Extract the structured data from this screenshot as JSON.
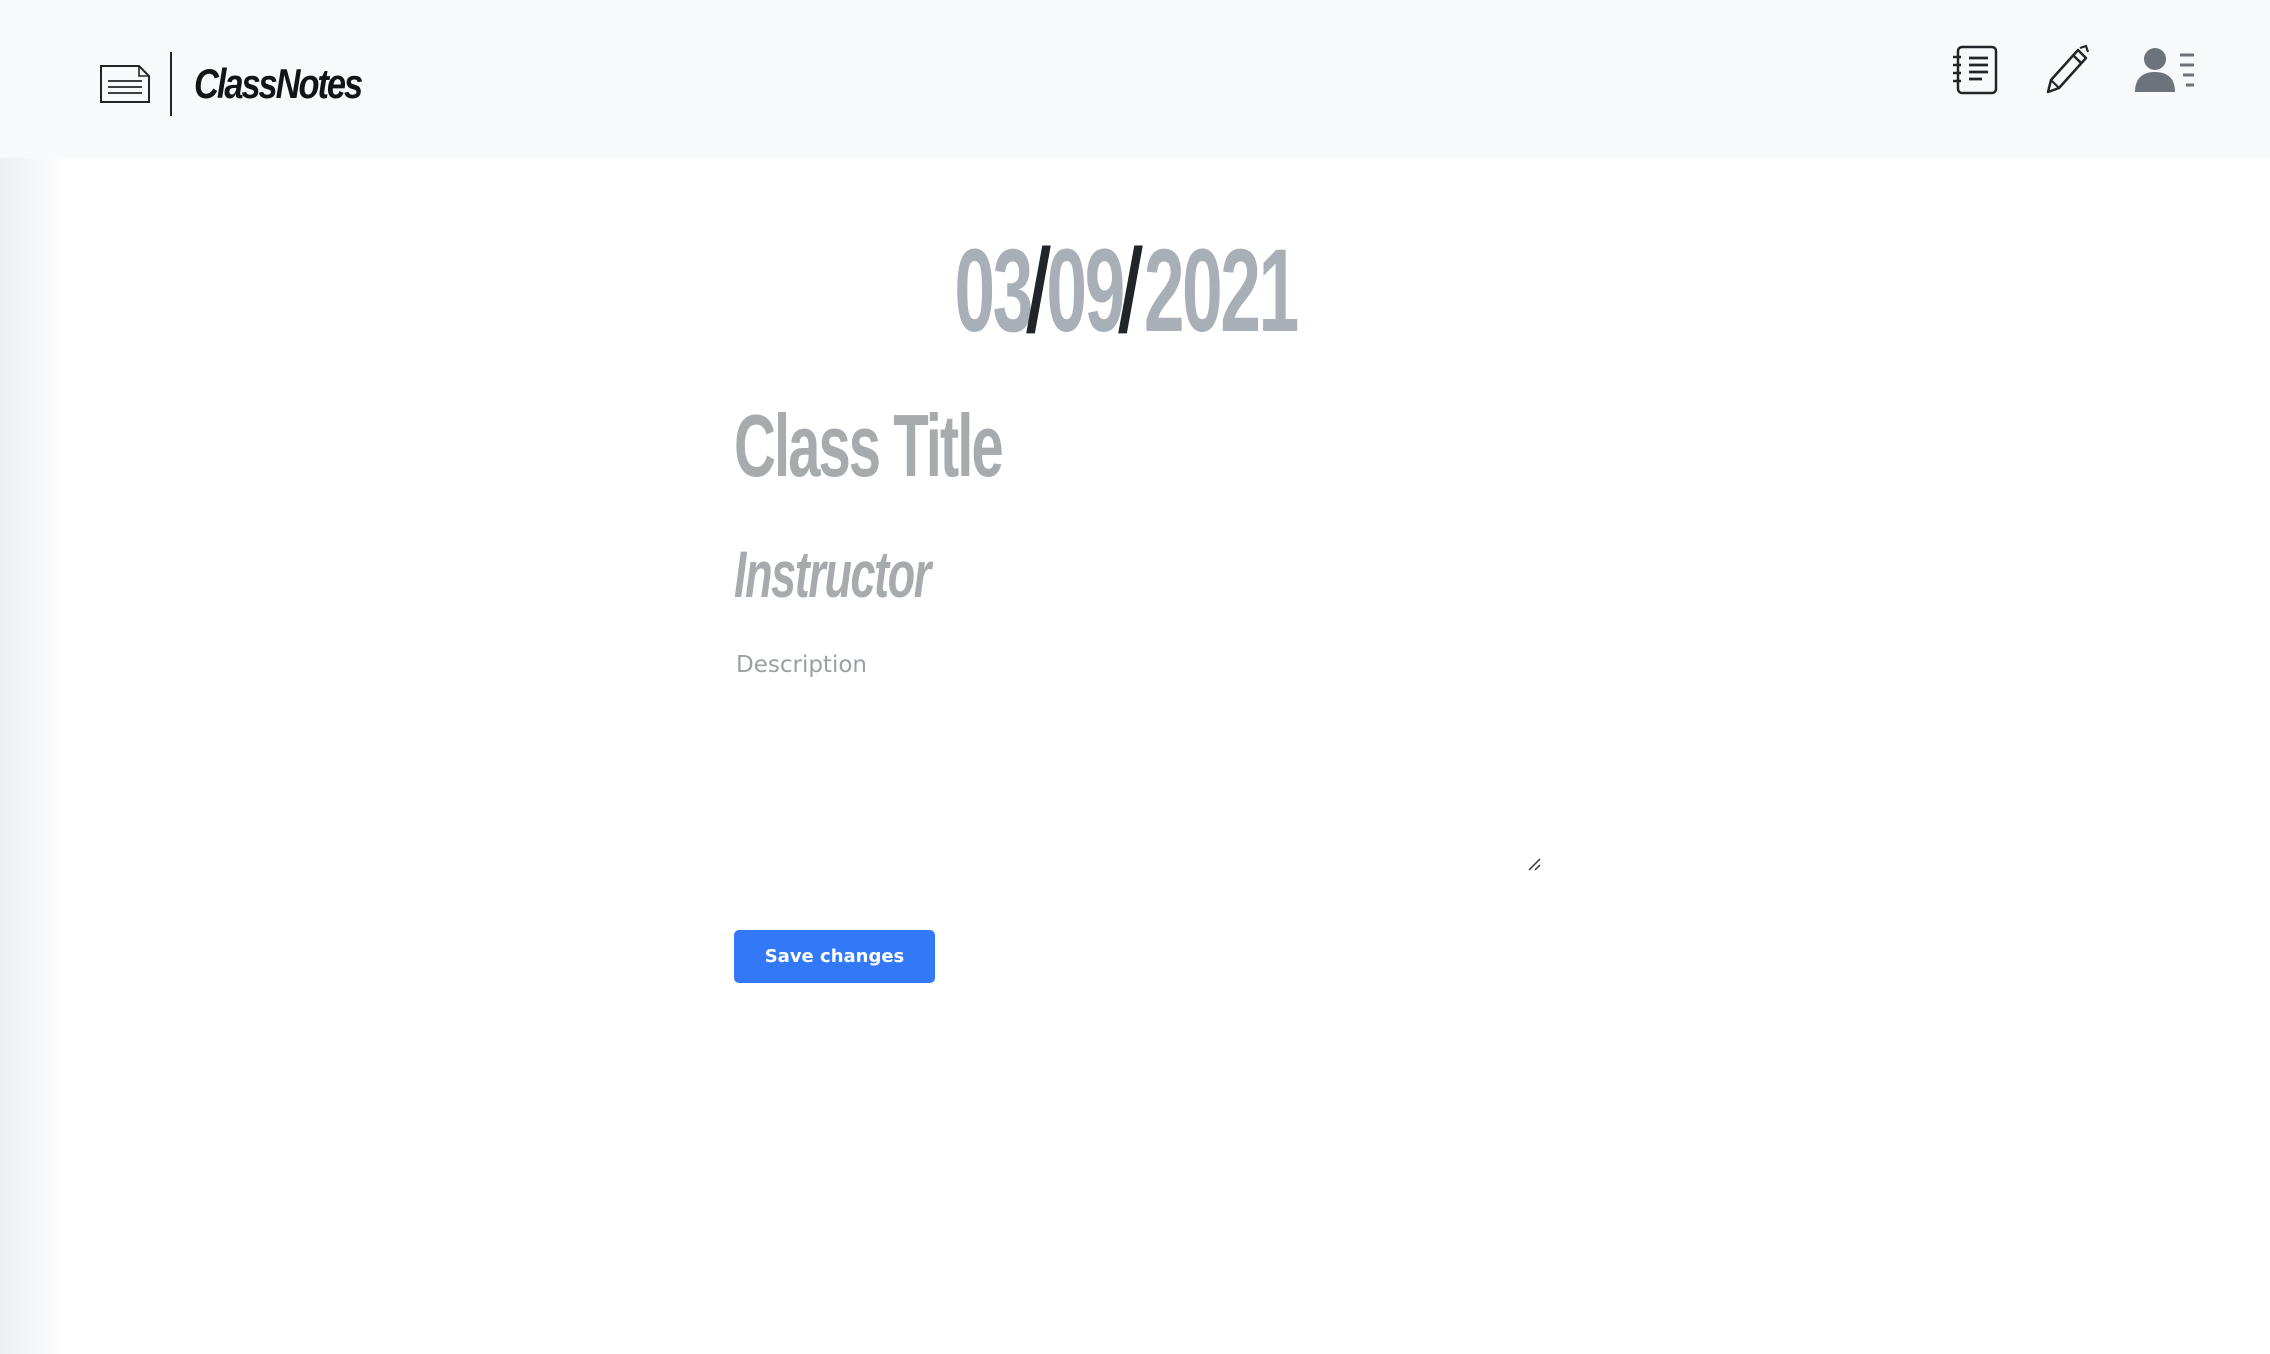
{
  "app": {
    "brand_name": "ClassNotes",
    "brand_icon": "document-lines-icon"
  },
  "nav": {
    "items": [
      {
        "icon": "notebook-list-icon"
      },
      {
        "icon": "pencil-icon"
      },
      {
        "icon": "user-profile-icon"
      }
    ]
  },
  "form": {
    "date": {
      "month": "03",
      "day": "09",
      "year": "2021",
      "separator": "/"
    },
    "title_placeholder": "Class Title",
    "title_value": "",
    "instructor_placeholder": "Instructor",
    "instructor_value": "",
    "description_placeholder": "Description",
    "description_value": "",
    "save_label": "Save changes"
  },
  "colors": {
    "accent": "#3378f6",
    "navbar_bg": "#f8f9fa",
    "muted_text": "#a8abae"
  }
}
